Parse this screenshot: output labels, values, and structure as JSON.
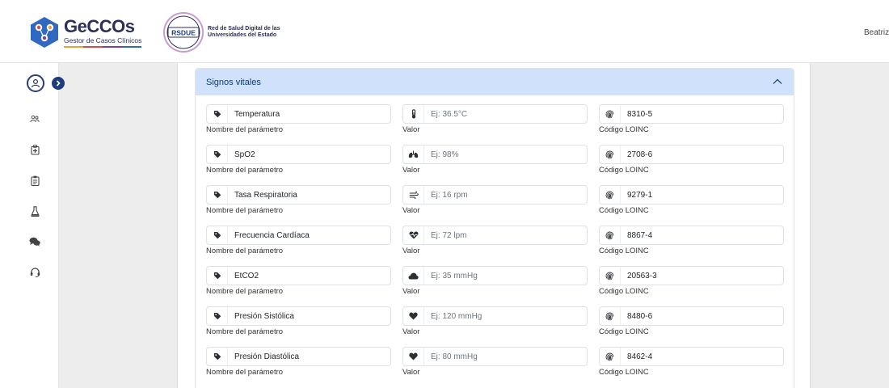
{
  "header": {
    "brand": "GeCCOs",
    "brand_sub": "Gestor de Casos Clínicos",
    "partner_badge": "RSDUE",
    "partner_name": "Red de Salud Digital de las Universidades del Estado",
    "user_name": "Beatriz"
  },
  "colors": {
    "accent": "#1f3d7a",
    "accordion_header": "#d0e2fb",
    "brand_bars": [
      "#e8a13b",
      "#d94b4b",
      "#7a3fa0",
      "#2f6ac0"
    ]
  },
  "sidebar": {
    "items": [
      {
        "icon": "users-icon"
      },
      {
        "icon": "medical-kit-icon"
      },
      {
        "icon": "clipboard-icon"
      },
      {
        "icon": "flask-icon"
      },
      {
        "icon": "chat-icon"
      },
      {
        "icon": "headset-icon"
      }
    ]
  },
  "section": {
    "title": "Signos vitales"
  },
  "labels": {
    "name": "Nombre del parámetro",
    "value": "Valor",
    "code": "Código LOINC"
  },
  "rows": [
    {
      "name": "Temperatura",
      "value_placeholder": "Ej: 36.5°C",
      "value_icon": "thermometer-icon",
      "code": "8310-5"
    },
    {
      "name": "SpO2",
      "value_placeholder": "Ej: 98%",
      "value_icon": "lungs-icon",
      "code": "2708-6"
    },
    {
      "name": "Tasa Respiratoria",
      "value_placeholder": "Ej: 16 rpm",
      "value_icon": "wind-icon",
      "code": "9279-1"
    },
    {
      "name": "Frecuencia Cardíaca",
      "value_placeholder": "Ej: 72 lpm",
      "value_icon": "heart-pulse-icon",
      "code": "8867-4"
    },
    {
      "name": "EtCO2",
      "value_placeholder": "Ej: 35 mmHg",
      "value_icon": "cloud-icon",
      "code": "20563-3"
    },
    {
      "name": "Presión Sistólica",
      "value_placeholder": "Ej: 120 mmHg",
      "value_icon": "heart-icon",
      "code": "8480-6"
    },
    {
      "name": "Presión Diastólica",
      "value_placeholder": "Ej: 80 mmHg",
      "value_icon": "heart-icon",
      "code": "8462-4"
    }
  ]
}
